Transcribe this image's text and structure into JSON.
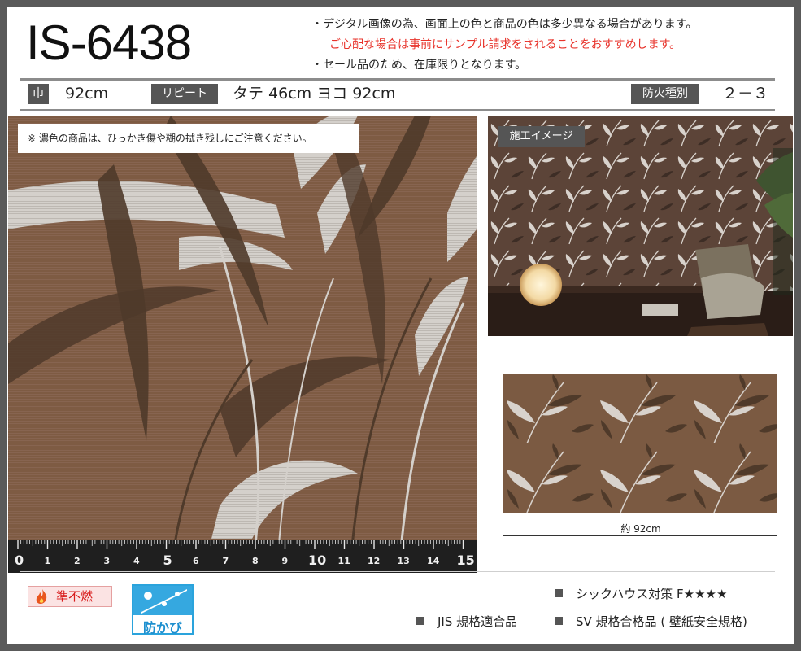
{
  "product": {
    "code": "IS-6438"
  },
  "notes": [
    "・デジタル画像の為、画面上の色と商品の色は多少異なる場合があります。",
    "ご心配な場合は事前にサンプル請求をされることをおすすめします。",
    "・セール品のため、在庫限りとなります。"
  ],
  "specs": {
    "width_label": "巾",
    "width_value": "92cm",
    "repeat_label": "リピート",
    "repeat_value": "タテ 46cm ヨコ 92cm",
    "fire_label": "防火種別",
    "fire_value": "２－３"
  },
  "swatch": {
    "caution": "※ 濃色の商品は、ひっかき傷や糊の拭き残しにご注意ください。",
    "ruler_numbers": [
      "0",
      "1",
      "2",
      "3",
      "4",
      "5",
      "6",
      "7",
      "8",
      "9",
      "10",
      "11",
      "12",
      "13",
      "14",
      "15"
    ]
  },
  "room_image": {
    "label": "施工イメージ"
  },
  "repeat_preview": {
    "width_text": "約 92cm"
  },
  "badges": {
    "fire": "準不燃",
    "mold": "防かび"
  },
  "certifications": {
    "sick_house": "シックハウス対策 F★★★★",
    "jis": "JIS 規格適合品",
    "sv": "SV 規格合格品 ( 壁紙安全規格)"
  },
  "colors": {
    "wallpaper_base": "#7e5b43",
    "leaf_dark": "#4f3a2a",
    "leaf_light": "#cfcac4",
    "accent_red": "#e8332b",
    "label_bg": "#555555"
  }
}
